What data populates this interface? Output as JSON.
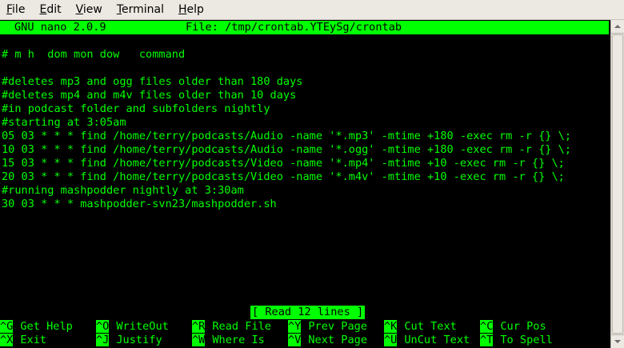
{
  "menubar": {
    "items": [
      {
        "label": "File",
        "accel": "F",
        "rest": "ile"
      },
      {
        "label": "Edit",
        "accel": "E",
        "rest": "dit"
      },
      {
        "label": "View",
        "accel": "V",
        "rest": "iew"
      },
      {
        "label": "Terminal",
        "accel": "T",
        "rest": "erminal"
      },
      {
        "label": "Help",
        "accel": "H",
        "rest": "elp"
      }
    ]
  },
  "nano": {
    "version_label": "GNU nano 2.0.9",
    "file_label": "File: /tmp/crontab.YTEySg/crontab",
    "lines": [
      "",
      "# m h  dom mon dow   command",
      "",
      "#deletes mp3 and ogg files older than 180 days",
      "#deletes mp4 and m4v files older than 10 days",
      "#in podcast folder and subfolders nightly",
      "#starting at 3:05am",
      "05 03 * * * find /home/terry/podcasts/Audio -name '*.mp3' -mtime +180 -exec rm -r {} \\;",
      "10 03 * * * find /home/terry/podcasts/Audio -name '*.ogg' -mtime +180 -exec rm -r {} \\;",
      "15 03 * * * find /home/terry/podcasts/Video -name '*.mp4' -mtime +10 -exec rm -r {} \\;",
      "20 03 * * * find /home/terry/podcasts/Video -name '*.m4v' -mtime +10 -exec rm -r {} \\;",
      "#running mashpodder nightly at 3:30am",
      "30 03 * * * mashpodder-svn23/mashpodder.sh"
    ],
    "status": "[ Read 12 lines ]",
    "shortcuts_row1": [
      {
        "key": "^G",
        "label": "Get Help"
      },
      {
        "key": "^O",
        "label": "WriteOut"
      },
      {
        "key": "^R",
        "label": "Read File"
      },
      {
        "key": "^Y",
        "label": "Prev Page"
      },
      {
        "key": "^K",
        "label": "Cut Text"
      },
      {
        "key": "^C",
        "label": "Cur Pos"
      }
    ],
    "shortcuts_row2": [
      {
        "key": "^X",
        "label": "Exit"
      },
      {
        "key": "^J",
        "label": "Justify"
      },
      {
        "key": "^W",
        "label": "Where Is"
      },
      {
        "key": "^V",
        "label": "Next Page"
      },
      {
        "key": "^U",
        "label": "UnCut Text"
      },
      {
        "key": "^T",
        "label": "To Spell"
      }
    ]
  },
  "colors": {
    "terminal_bg": "#000000",
    "terminal_fg": "#00ff00",
    "menubar_bg": "#ece9e2"
  }
}
